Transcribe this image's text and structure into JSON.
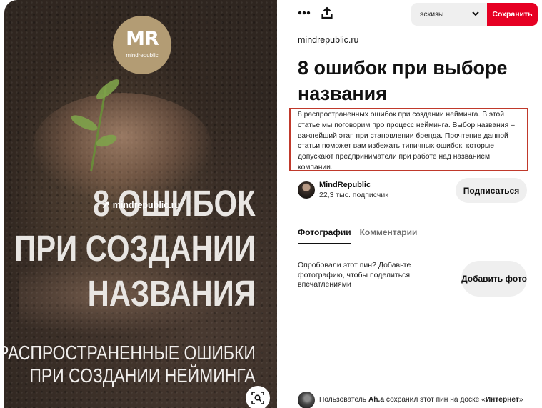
{
  "image": {
    "logo_mark": "MR",
    "logo_sub": "mindrepublic",
    "watermark": "mindrepublic.ru",
    "headline_line1": "8 ОШИБОК",
    "headline_line2": "ПРИ СОЗДАНИИ",
    "headline_line3": "НАЗВАНИЯ",
    "sub_line1": "РАСПРОСТРАНЕННЫЕ ОШИБКИ",
    "sub_line2": "ПРИ СОЗДАНИИ НЕЙМИНГА",
    "lens_icon": "visual-search-icon"
  },
  "toolbar": {
    "more_icon": "more-dots-icon",
    "share_icon": "share-upload-icon",
    "board_select_value": "эскизы",
    "save_label": "Сохранить",
    "accent_color": "#e60023"
  },
  "pin": {
    "source": "mindrepublic.ru",
    "title": "8 ошибок при выборе названия",
    "description": "8 распространенных ошибок при создании нейминга. В этой статье мы поговорим про процесс нейминга. Выбор названия – важнейший этап при становлении бренда. Прочтение данной статьи поможет вам избежать типичных ошибок, которые допускают предприниматели при работе над названием компании."
  },
  "author": {
    "name": "MindRepublic",
    "followers": "22,3 тыс. подписчик",
    "follow_label": "Подписаться"
  },
  "tabs": [
    {
      "label": "Фотографии",
      "active": true
    },
    {
      "label": "Комментарии",
      "active": false
    }
  ],
  "tried": {
    "text": "Опробовали этот пин? Добавьте фотографию, чтобы поделиться впечатлениями",
    "button_label": "Добавить фото"
  },
  "saver": {
    "prefix": "Пользователь ",
    "user": "Ah.a",
    "middle": " сохранил этот пин на доске «",
    "board": "Интернет",
    "suffix": "»"
  }
}
